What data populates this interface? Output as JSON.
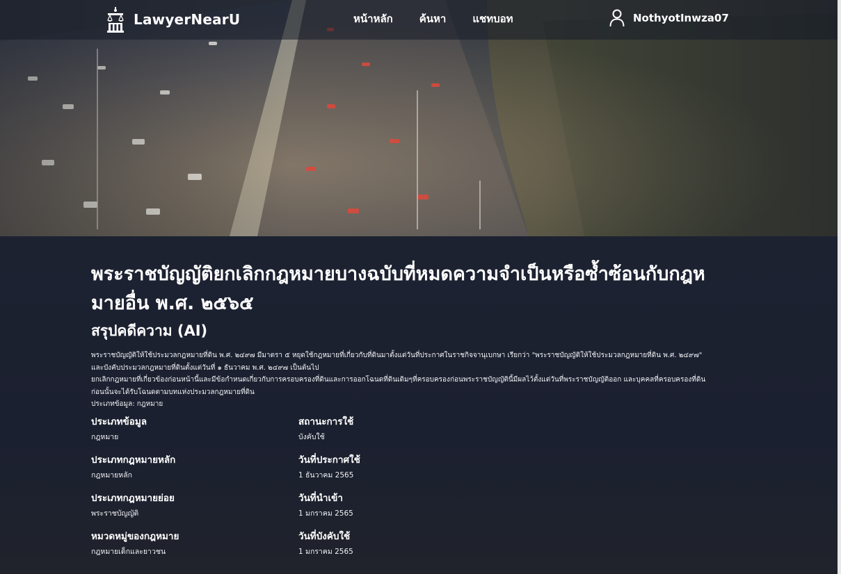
{
  "navbar": {
    "brand_name": "LawyerNearU",
    "links": [
      "หน้าหลัก",
      "ค้นหา",
      "แชทบอท"
    ],
    "user_name": "NothyotInwza07",
    "icons": {
      "brand": "scales-building-logo-icon",
      "user": "user-icon"
    }
  },
  "law": {
    "title": "พระราชบัญญัติยกเลิกกฎหมายบางฉบับที่หมดความจำเป็นหรือซ้ำซ้อนกับกฎหมายอื่น พ.ศ. ๒๕๖๕",
    "summary_heading": "สรุปคดีความ (AI)",
    "summary_lines": [
      "พระราชบัญญัติให้ใช้ประมวลกฎหมายที่ดิน พ.ศ. ๒๔๙๗ มีมาตรา ๕ หยุดใช้กฎหมายที่เกี่ยวกับที่ดินมาตั้งแต่วันที่ประกาศในราชกิจจานุเบกษา เรียกว่า \"พระราชบัญญัติให้ใช้ประมวลกฎหมายที่ดิน พ.ศ. ๒๔๙๗\" และบังคับประมวลกฎหมายที่ดินตั้งแต่วันที่ ๑ ธันวาคม พ.ศ. ๒๔๙๗ เป็นต้นไป",
      "ยกเลิกกฎหมายที่เกี่ยวข้องก่อนหน้านี้และมีข้อกำหนดเกี่ยวกับการครอบครองที่ดินและการออกโฉนดที่ดินเดิมๆที่ครอบครองก่อนพระราชบัญญัตินี้มีผลไว้ตั้งแต่วันที่พระราชบัญญัติออก และบุคคลที่ครอบครองที่ดินก่อนนั้นจะได้รับโฉนดตามบทแห่งประมวลกฎหมายที่ดิน",
      "ประเภทข้อมูล: กฎหมาย"
    ],
    "details": [
      {
        "label": "ประเภทข้อมูล",
        "value": "กฎหมาย"
      },
      {
        "label": "สถานะการใช้",
        "value": "บังคับใช้"
      },
      {
        "label": "ประเภทกฎหมายหลัก",
        "value": "กฎหมายหลัก"
      },
      {
        "label": "วันที่ประกาศใช้",
        "value": "1 ธันวาคม 2565"
      },
      {
        "label": "ประเภทกฎหมายย่อย",
        "value": "พระราชบัญญัติ"
      },
      {
        "label": "วันที่นำเข้า",
        "value": "1 มกราคม 2565"
      },
      {
        "label": "หมวดหมู่ของกฎหมาย",
        "value": "กฎหมายเด็กและยาวชน"
      },
      {
        "label": "วันที่บังคับใช้",
        "value": "1 มกราคม 2565"
      }
    ]
  },
  "colors": {
    "background": "#1b2030",
    "text": "#ffffff",
    "navbar": "#161b28"
  }
}
